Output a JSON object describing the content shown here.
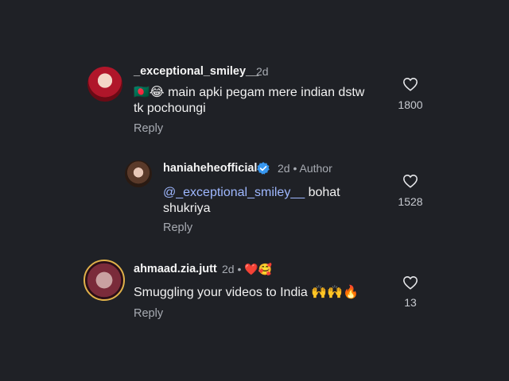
{
  "comments": [
    {
      "username": "_exceptional_smiley__",
      "time": "2d",
      "text_emoji": "🇧🇩😂",
      "text": "main apki pegam mere indian dstw",
      "text_line2": "tk pochoungi",
      "reply_label": "Reply",
      "likes": "1800"
    },
    {
      "username": "haniaheheofficial",
      "time": "2d",
      "separator": "•",
      "author_label": "Author",
      "mention": "@_exceptional_smiley__",
      "text": " bohat",
      "text_line2": "shukriya",
      "reply_label": "Reply",
      "likes": "1528"
    },
    {
      "username": "ahmaad.zia.jutt",
      "time": "2d",
      "separator": "•",
      "badge_emoji": "❤️🥰",
      "text": "Smuggling your videos to India 🙌🙌🔥",
      "reply_label": "Reply",
      "likes": "13"
    }
  ],
  "colors": {
    "background": "#1f2126",
    "verified": "#3797f0",
    "mention": "#9fb8ff"
  }
}
